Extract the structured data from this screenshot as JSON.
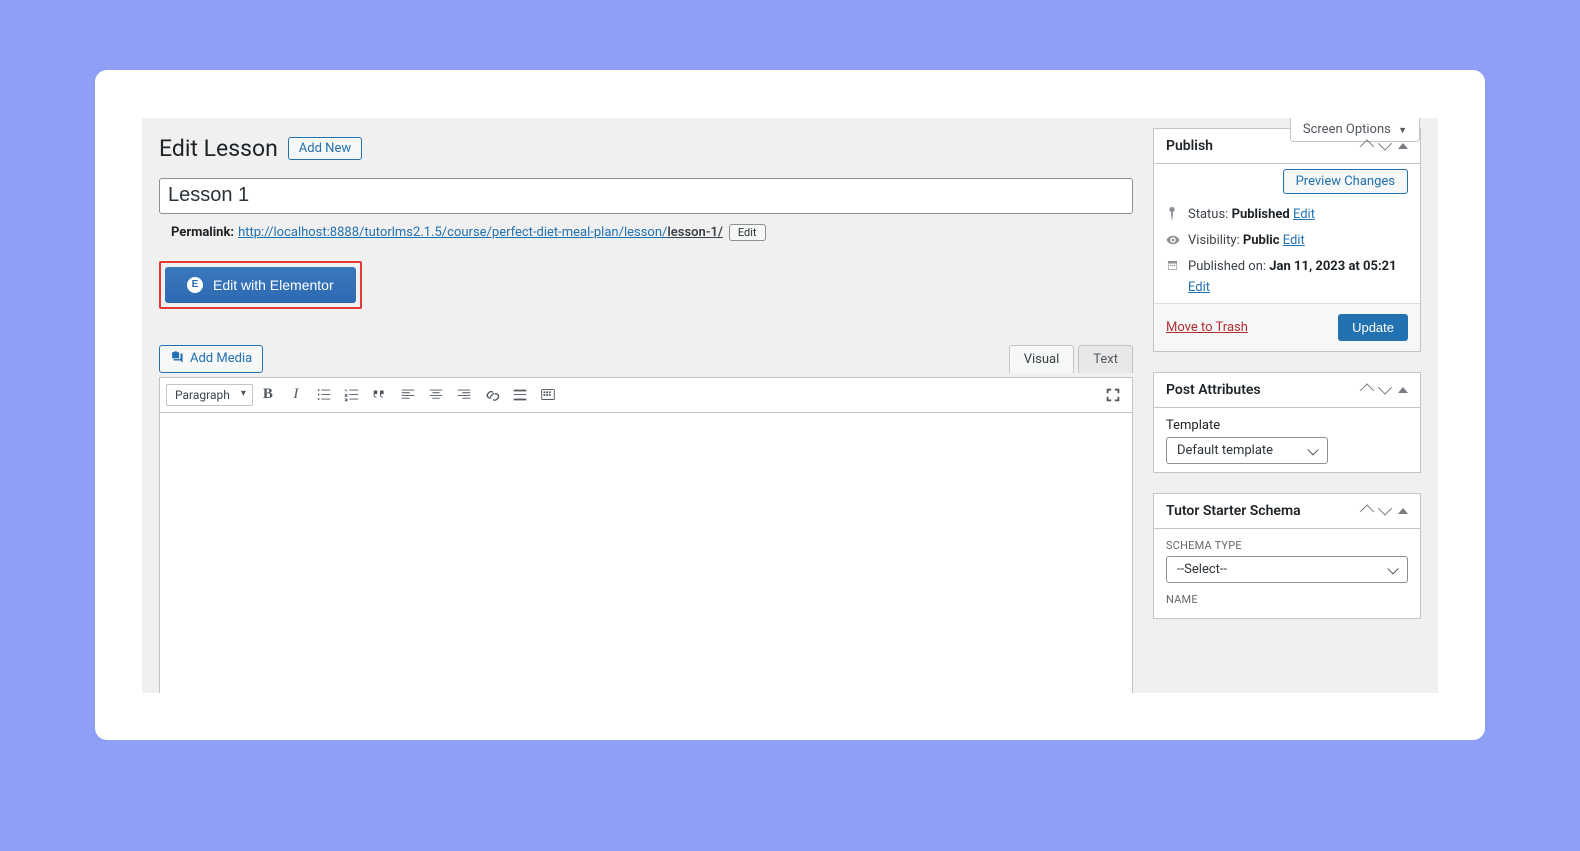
{
  "screen_options_label": "Screen Options",
  "page_title": "Edit Lesson",
  "add_new_label": "Add New",
  "title_value": "Lesson 1",
  "permalink": {
    "label": "Permalink:",
    "base": "http://localhost:8888/tutorlms2.1.5/course/perfect-diet-meal-plan/lesson/",
    "slug": "lesson-1/",
    "edit_label": "Edit"
  },
  "elementor_button_label": "Edit with Elementor",
  "add_media_label": "Add Media",
  "editor_tabs": {
    "visual": "Visual",
    "text": "Text"
  },
  "format_selected": "Paragraph",
  "publish": {
    "title": "Publish",
    "preview_label": "Preview Changes",
    "status_label": "Status:",
    "status_value": "Published",
    "visibility_label": "Visibility:",
    "visibility_value": "Public",
    "published_label": "Published on:",
    "published_value": "Jan 11, 2023 at 05:21",
    "edit_label": "Edit",
    "trash_label": "Move to Trash",
    "update_label": "Update"
  },
  "post_attributes": {
    "title": "Post Attributes",
    "template_label": "Template",
    "template_value": "Default template"
  },
  "schema": {
    "title": "Tutor Starter Schema",
    "type_label": "SCHEMA TYPE",
    "type_value": "--Select--",
    "name_label": "NAME"
  }
}
